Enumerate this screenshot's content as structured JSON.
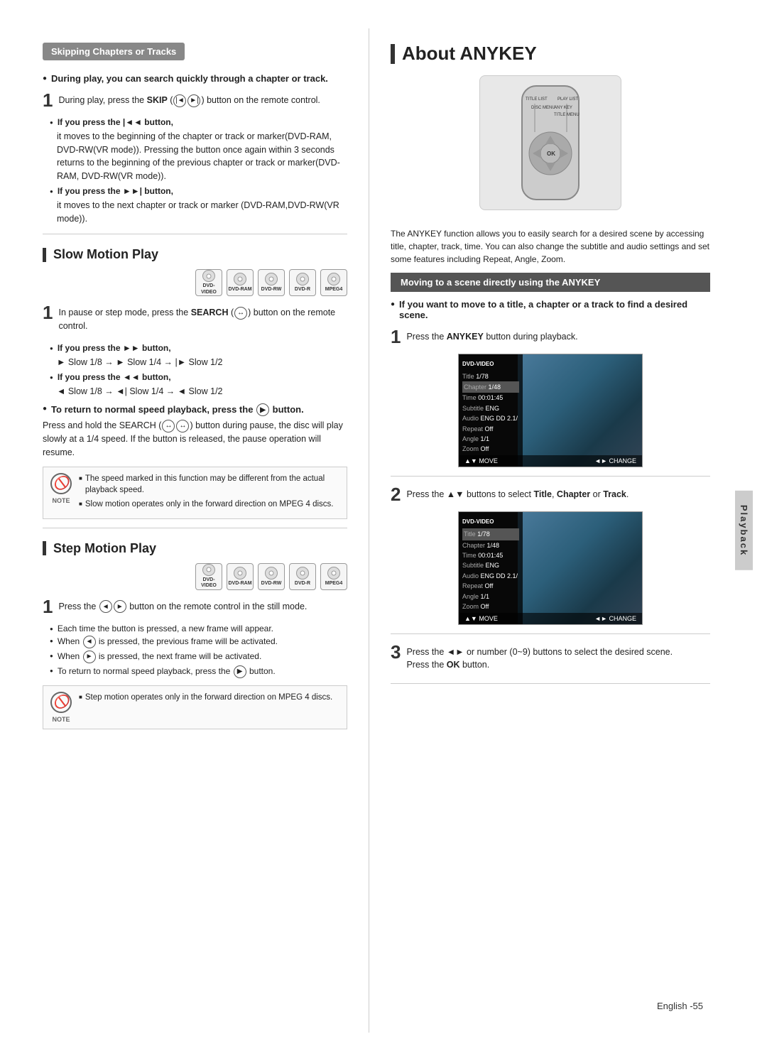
{
  "left": {
    "skipping_section": {
      "header": "Skipping Chapters or Tracks",
      "bullet1": "During play, you can search quickly through a chapter or track.",
      "step1": {
        "num": "1",
        "text": "During play, press the SKIP (",
        "text2": ") button on the remote control."
      },
      "if_press_back_header": "If you press the |◄◄ button,",
      "if_press_back_text": "it moves to the beginning of the chapter or track or marker(DVD-RAM, DVD-RW(VR mode)). Pressing the button once again within 3 seconds returns to the beginning of the previous chapter or track or marker(DVD-RAM, DVD-RW(VR mode)).",
      "if_press_fwd_header": "If you press the ►►| button,",
      "if_press_fwd_text": "it moves to the next chapter or track or marker (DVD-RAM,DVD-RW(VR mode))."
    },
    "slow_motion": {
      "header": "Slow Motion Play",
      "step1": {
        "num": "1",
        "text": "In pause or step mode, press the SEARCH (",
        "text2": ") button on the remote control."
      },
      "if_fwd_header": "If you press the ►► button,",
      "if_fwd_text": "► Slow 1/8 → ► Slow 1/4 → |► Slow 1/2",
      "if_back_header": "If you press the ◄◄ button,",
      "if_back_text": "◄ Slow 1/8 → ◄| Slow 1/4 → ◄ Slow 1/2",
      "return_header": "To return to normal speed playback, press the",
      "return_text": "button.",
      "para": "Press and hold the SEARCH (",
      "para2": ") button during pause, the disc will play slowly at a 1/4 speed. If the button is released, the pause operation will resume.",
      "note1": "The speed marked in this function may be different from the actual playback speed.",
      "note2": "Slow motion operates only in the forward direction on MPEG 4 discs."
    },
    "step_motion": {
      "header": "Step Motion Play",
      "step1": {
        "num": "1",
        "text": "Press the",
        "text2": "button on the remote control in the still mode."
      },
      "bullet1": "Each time the button is pressed, a new frame will appear.",
      "bullet2_pre": "When",
      "bullet2_post": "is pressed, the previous frame will be activated.",
      "bullet3_pre": "When",
      "bullet3_post": "is pressed, the next frame will be activated.",
      "bullet4": "To return to normal speed playback, press the",
      "bullet4_post": "button.",
      "note1": "Step motion operates only in the forward direction on MPEG 4 discs."
    }
  },
  "right": {
    "anykey_title": "About ANYKEY",
    "anykey_para": "The ANYKEY function allows you to easily search for a desired scene by accessing title, chapter, track, time. You can also change the subtitle and audio settings and set some features including Repeat, Angle, Zoom.",
    "moving_header": "Moving to a scene directly using the ANYKEY",
    "moving_bullet": "If you want to move to a title, a chapter or a track to find a desired scene.",
    "step1": {
      "num": "1",
      "text": "Press the ANYKEY button during playback."
    },
    "step2": {
      "num": "2",
      "text": "Press the ▲▼ buttons to select Title, Chapter or Track."
    },
    "step3": {
      "num": "3",
      "text": "Press the ◄► or number (0~9) buttons to select the desired scene. Press the OK button."
    },
    "screen1": {
      "title_label": "Title",
      "title_val": "1/78",
      "chapter_label": "Chapter",
      "chapter_val": "1/48",
      "time_label": "Time",
      "time_val": "00:01:45",
      "subtitle_label": "Subtitle",
      "subtitle_val": "ENG",
      "audio_label": "Audio",
      "audio_val": "ENG DD 2.1/",
      "repeat_label": "Repeat",
      "repeat_val": "Off",
      "angle_label": "Angle",
      "angle_val": "1/1",
      "zoom_label": "Zoom",
      "zoom_val": "Off",
      "move": "MOVE",
      "change": "CHANGE",
      "disc_type": "DVD-VIDEO"
    },
    "screen2": {
      "title_label": "Title",
      "title_val": "1/78",
      "chapter_label": "Chapter",
      "chapter_val": "1/48",
      "time_label": "Time",
      "time_val": "00:01:45",
      "subtitle_label": "Subtitle",
      "subtitle_val": "ENG",
      "audio_label": "Audio",
      "audio_val": "ENG DD 2.1/",
      "repeat_label": "Repeat",
      "repeat_val": "Off",
      "angle_label": "Angle",
      "angle_val": "1/1",
      "zoom_label": "Zoom",
      "zoom_val": "Off",
      "move": "MOVE",
      "change": "CHANGE",
      "disc_type": "DVD-VIDEO"
    }
  },
  "footer": {
    "language": "English",
    "page": "-55",
    "side_tab": "Playback"
  },
  "disc_types": [
    "DVD-VIDEO",
    "DVD-RAM",
    "DVD-RW",
    "DVD-R",
    "MPEG4"
  ],
  "remote_labels": [
    "TITLE LIST",
    "PLAY LIST",
    "DISC MENU",
    "TITLE MENU",
    "ANY KEY"
  ]
}
